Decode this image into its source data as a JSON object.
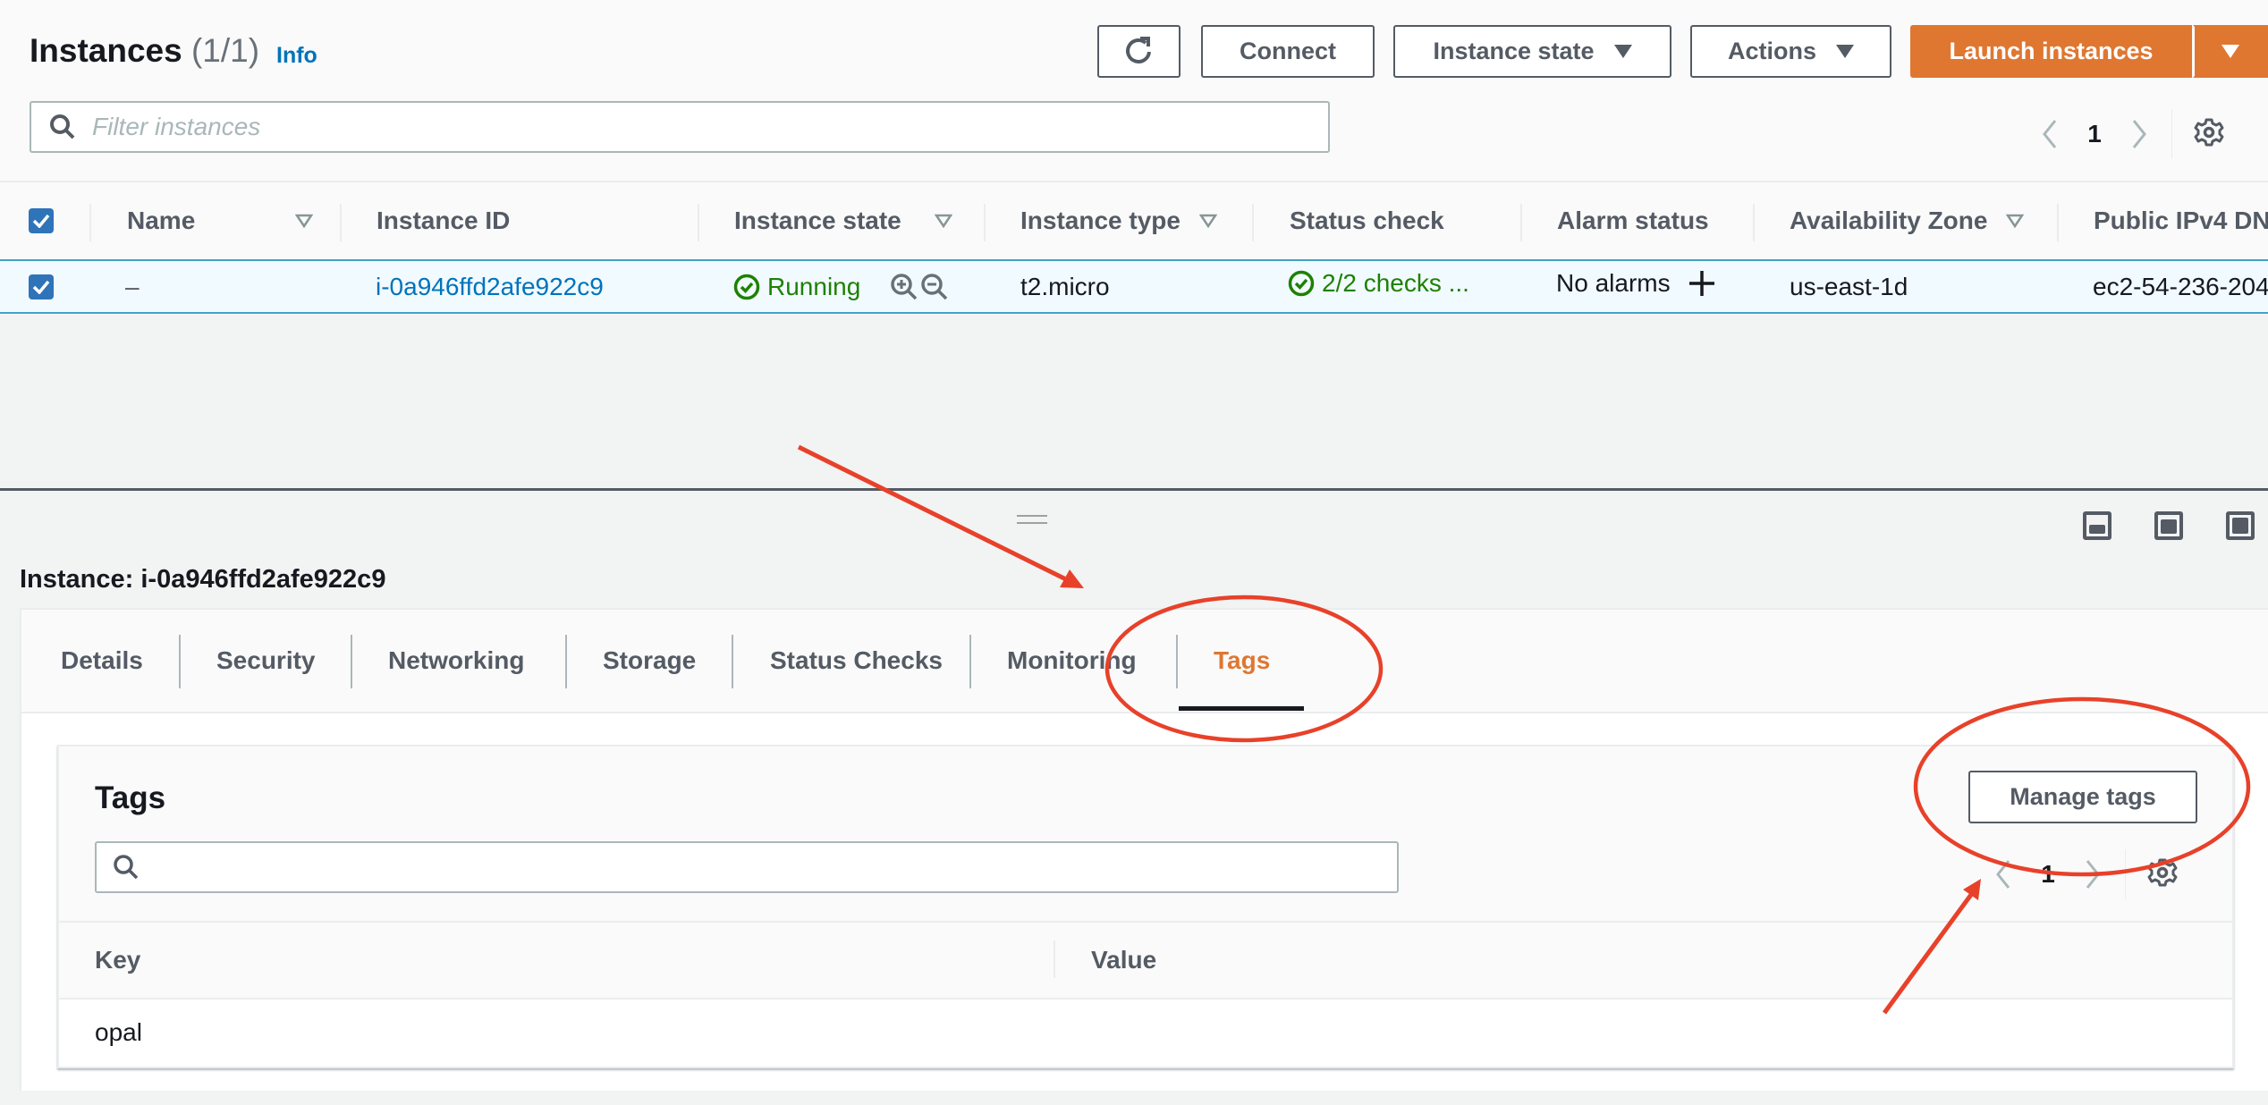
{
  "header": {
    "title": "Instances",
    "count": "(1/1)",
    "info_link": "Info"
  },
  "toolbar": {
    "refresh_label": "Refresh",
    "connect_label": "Connect",
    "instance_state_label": "Instance state",
    "actions_label": "Actions",
    "launch_label": "Launch instances"
  },
  "filter": {
    "placeholder": "Filter instances",
    "value": ""
  },
  "pagination": {
    "current_page": "1"
  },
  "instances_table": {
    "columns": [
      {
        "label": "Name",
        "sortable": true
      },
      {
        "label": "Instance ID",
        "sortable": false
      },
      {
        "label": "Instance state",
        "sortable": true
      },
      {
        "label": "Instance type",
        "sortable": true
      },
      {
        "label": "Status check",
        "sortable": false
      },
      {
        "label": "Alarm status",
        "sortable": false
      },
      {
        "label": "Availability Zone",
        "sortable": true
      },
      {
        "label": "Public IPv4 DN",
        "sortable": false
      }
    ],
    "rows": [
      {
        "selected": true,
        "name": "–",
        "instance_id": "i-0a946ffd2afe922c9",
        "instance_state": "Running",
        "instance_type": "t2.micro",
        "status_check": "2/2 checks ...",
        "alarm_status": "No alarms",
        "availability_zone": "us-east-1d",
        "public_ipv4_dns": "ec2-54-236-204"
      }
    ]
  },
  "details": {
    "title": "Instance: i-0a946ffd2afe922c9",
    "tabs": [
      {
        "label": "Details",
        "active": false
      },
      {
        "label": "Security",
        "active": false
      },
      {
        "label": "Networking",
        "active": false
      },
      {
        "label": "Storage",
        "active": false
      },
      {
        "label": "Status Checks",
        "active": false
      },
      {
        "label": "Monitoring",
        "active": false
      },
      {
        "label": "Tags",
        "active": true
      }
    ]
  },
  "tags_panel": {
    "heading": "Tags",
    "manage_label": "Manage tags",
    "search_placeholder": "",
    "current_page": "1",
    "columns": [
      "Key",
      "Value"
    ],
    "rows": [
      {
        "key": "opal",
        "value": ""
      }
    ]
  },
  "colors": {
    "accent_orange": "#df7731",
    "link_blue": "#0073bb",
    "success_green": "#1d8102",
    "annotation_red": "#e8412a",
    "selection_border": "#44a0c8"
  }
}
